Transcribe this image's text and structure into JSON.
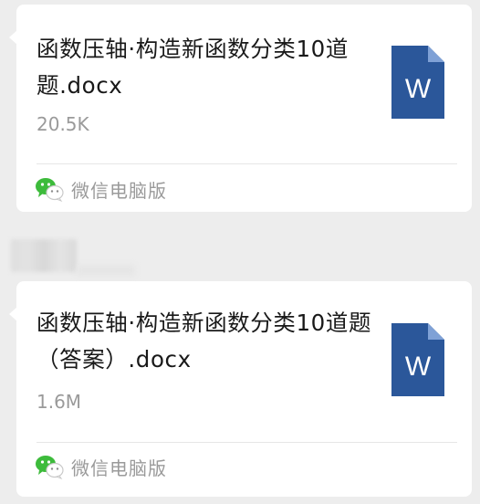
{
  "messages": [
    {
      "file_name": "函数压轴·构造新函数分类10道题.docx",
      "file_size": "20.5K",
      "file_icon": "word-document-icon",
      "file_icon_letter": "W",
      "source_icon": "wechat-icon",
      "source_label": "微信电脑版"
    },
    {
      "file_name": "函数压轴·构造新函数分类10道题（答案）.docx",
      "file_size": "1.6M",
      "file_icon": "word-document-icon",
      "file_icon_letter": "W",
      "source_icon": "wechat-icon",
      "source_label": "微信电脑版"
    }
  ],
  "colors": {
    "background": "#ededed",
    "bubble": "#ffffff",
    "word_blue": "#2b579a",
    "wechat_green": "#3dbb3b",
    "secondary_text": "#9a9a9a"
  }
}
